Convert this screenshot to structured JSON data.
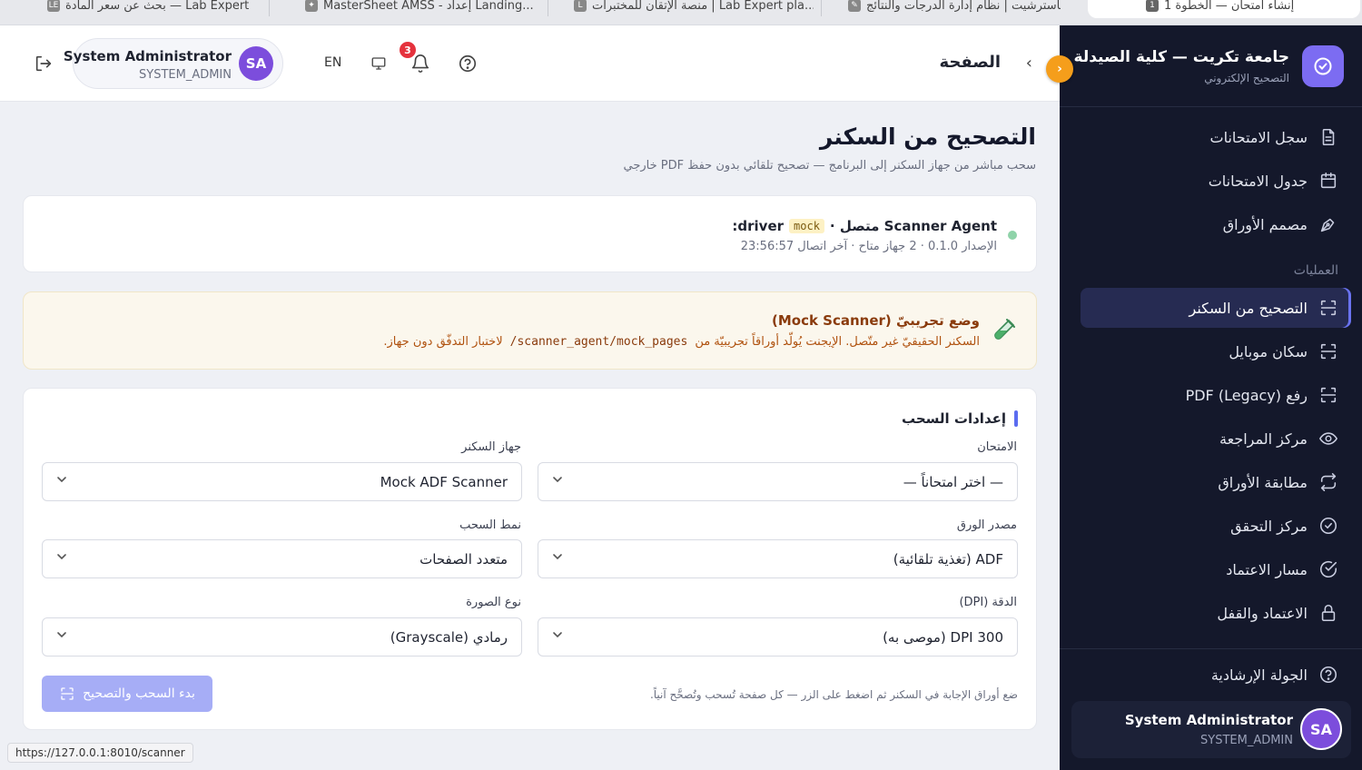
{
  "browser": {
    "tabs": [
      {
        "title": "بحث عن سعر المادة — Lab Expert",
        "favicon": "LE"
      },
      {
        "title": "MasterSheet AMSS - إعداد Landing...",
        "favicon": "✦"
      },
      {
        "title": "منصة الإتقان للمختبرات | Lab Expert pla...",
        "favicon": "L"
      },
      {
        "title": "ماسترشيت | نظام إدارة الدرجات والنتائج",
        "favicon": "✎"
      },
      {
        "title": "إنشاء امتحان — الخطوة 1",
        "favicon": "1"
      }
    ],
    "status_url": "https://127.0.0.1:8010/scanner"
  },
  "sidebar": {
    "brand_title": "جامعة تكريت — كلية الصيدلة",
    "brand_subtitle": "التصحيح الإلكتروني",
    "top_items": [
      {
        "label": "سجل الامتحانات",
        "icon": "document-icon"
      },
      {
        "label": "جدول الامتحانات",
        "icon": "calendar-icon"
      },
      {
        "label": "مصمم الأوراق",
        "icon": "pen-tool-icon"
      }
    ],
    "section_label": "العمليات",
    "ops_items": [
      {
        "label": "التصحيح من السكنر",
        "icon": "scan-icon",
        "active": true
      },
      {
        "label": "سكان موبايل",
        "icon": "scan-icon",
        "active": false
      },
      {
        "label": "رفع PDF (Legacy)",
        "icon": "scan-icon",
        "active": false
      },
      {
        "label": "مركز المراجعة",
        "icon": "eye-icon",
        "active": false
      },
      {
        "label": "مطابقة الأوراق",
        "icon": "repeat-icon",
        "active": false
      },
      {
        "label": "مركز التحقق",
        "icon": "check-circle-icon",
        "active": false
      },
      {
        "label": "مسار الاعتماد",
        "icon": "check-circle-icon",
        "active": false
      },
      {
        "label": "الاعتماد والقفل",
        "icon": "lock-icon",
        "active": false
      }
    ],
    "tour_label": "الجولة الإرشادية",
    "user": {
      "name": "System Administrator",
      "role": "SYSTEM_ADMIN",
      "initials": "SA"
    }
  },
  "header": {
    "page_label": "الصفحة",
    "user": {
      "name": "System Administrator",
      "role": "SYSTEM_ADMIN",
      "initials": "SA"
    },
    "language": "EN",
    "notifications_count": "3"
  },
  "main": {
    "title": "التصحيح من السكنر",
    "subtitle": "سحب مباشر من جهاز السكنر إلى البرنامج — تصحيح تلقائي بدون حفظ PDF خارجي",
    "agent": {
      "title": "Scanner Agent متصل ·",
      "driver_label": "driver:",
      "driver_value": "mock",
      "meta": "الإصدار 0.1.0 · 2 جهاز متاح · آخر اتصال 23:56:57",
      "status_color": "#8fd3a9"
    },
    "mock": {
      "title": "وضع تجريبيّ (Mock Scanner)",
      "desc_before": "السكنر الحقيقيّ غير متّصل. الإيجنت يُولّد أوراقاً تجريبيّة من",
      "path": "/scanner_agent/mock_pages",
      "desc_after": "لاختبار التدفّق دون جهاز."
    },
    "settings": {
      "title": "إعدادات السحب",
      "fields": {
        "exam": {
          "label": "الامتحان",
          "value": "— اختر امتحاناً —"
        },
        "scanner": {
          "label": "جهاز السكنر",
          "value": "Mock ADF Scanner"
        },
        "source": {
          "label": "مصدر الورق",
          "value": "ADF (تغذية تلقائية)"
        },
        "mode": {
          "label": "نمط السحب",
          "value": "متعدد الصفحات"
        },
        "dpi": {
          "label": "الدقة (DPI)",
          "value": "300 DPI (موصى به)"
        },
        "color": {
          "label": "نوع الصورة",
          "value": "رمادي (Grayscale)"
        }
      },
      "hint": "ضع أوراق الإجابة في السكنر ثم اضغط على الزر — كل صفحة تُسحب وتُصحَّح آنياً.",
      "start_label": "بدء السحب والتصحيح"
    }
  }
}
